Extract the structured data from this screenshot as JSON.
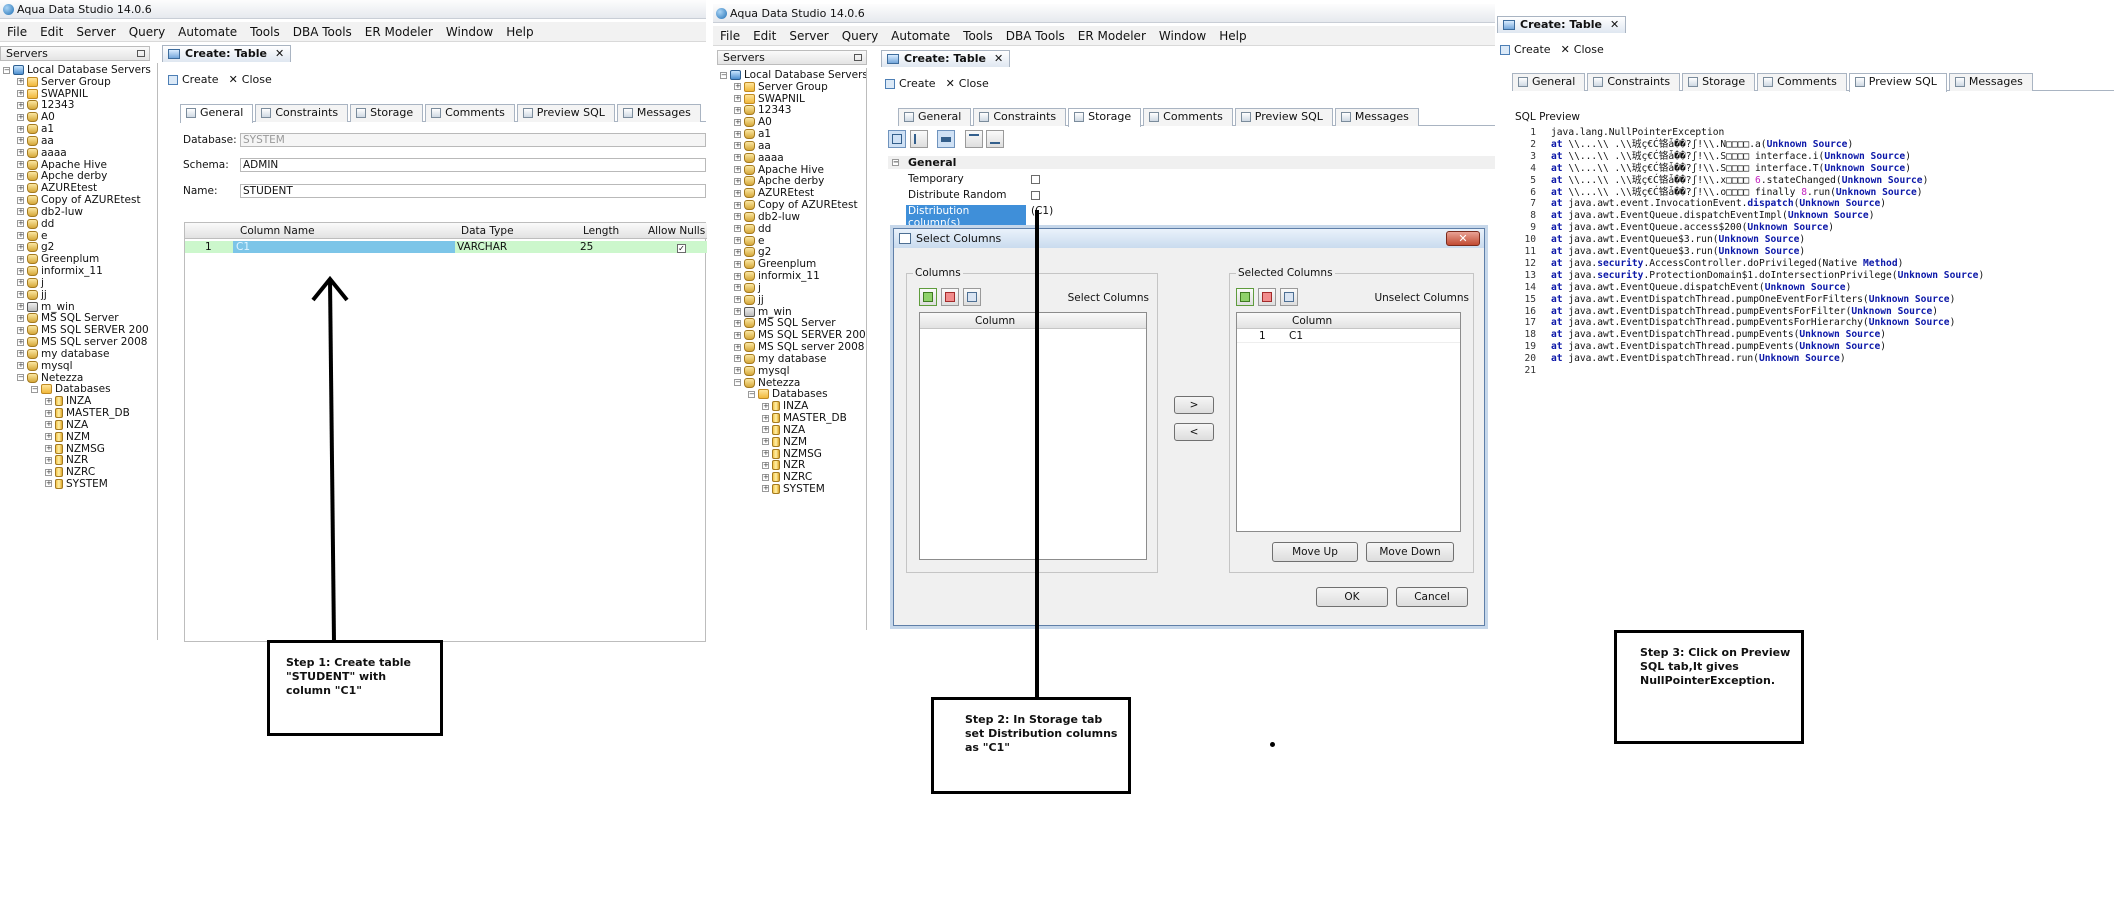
{
  "app_title": "Aqua Data Studio 14.0.6",
  "menu": [
    "File",
    "Edit",
    "Server",
    "Query",
    "Automate",
    "Tools",
    "DBA Tools",
    "ER Modeler",
    "Window",
    "Help"
  ],
  "servers_label": "Servers",
  "tree": {
    "root": "Local Database Servers",
    "items": [
      "Server Group",
      "SWAPNIL",
      "12343",
      "A0",
      "a1",
      "aa",
      "aaaa",
      "Apache Hive",
      "Apche derby",
      "AZUREtest",
      "Copy of AZUREtest",
      "db2-luw",
      "dd",
      "e",
      "g2",
      "Greenplum",
      "informix_11",
      "j",
      "jj",
      "m_win",
      "MS SQL Server",
      "MS SQL SERVER 200",
      "MS SQL server 2008",
      "my database",
      "mysql",
      "Netezza"
    ],
    "databases_label": "Databases",
    "databases": [
      "INZA",
      "MASTER_DB",
      "NZA",
      "NZM",
      "NZMSG",
      "NZR",
      "NZRC",
      "SYSTEM"
    ]
  },
  "doc_tab": "Create: Table",
  "close_tab": "✕",
  "toolbar": {
    "create": "Create",
    "close": "Close",
    "close_glyph": "✕"
  },
  "tabs": [
    "General",
    "Constraints",
    "Storage",
    "Comments",
    "Preview SQL",
    "Messages"
  ],
  "panel1": {
    "database_label": "Database:",
    "database_value": "SYSTEM",
    "schema_label": "Schema:",
    "schema_value": "ADMIN",
    "name_label": "Name:",
    "name_value": "STUDENT",
    "columns_header": [
      "Column Name",
      "Data Type",
      "Length",
      "Allow Nulls"
    ],
    "row": {
      "num": "1",
      "name": "C1",
      "type": "VARCHAR",
      "length": "25",
      "check": "✓"
    }
  },
  "panel2": {
    "section": "General",
    "props": [
      "Temporary",
      "Distribute Random",
      "Distribution column(s)"
    ],
    "distribution_value": "(C1)",
    "dialog": {
      "title": "Select Columns",
      "close_glyph": "✕",
      "columns_legend": "Columns",
      "select_columns": "Select Columns",
      "selected_legend": "Selected Columns",
      "unselect_columns": "Unselect Columns",
      "column_header": "Column",
      "selected_row": {
        "num": "1",
        "name": "C1"
      },
      "add_glyph": ">",
      "remove_glyph": "<",
      "move_up": "Move Up",
      "move_down": "Move Down",
      "ok": "OK",
      "cancel": "Cancel"
    }
  },
  "panel3": {
    "sql_preview_label": "SQL Preview",
    "lines": [
      {
        "n": "1",
        "parts": [
          {
            "t": "java.lang.NullPointerException"
          }
        ]
      },
      {
        "n": "2",
        "parts": [
          {
            "t": "    at ",
            "c": "kw"
          },
          {
            "t": "\\\\...\\\\ .\\\\珬ç€Ć铬ǡ��?ʃǃ\\\\.N□□□□.a("
          },
          {
            "t": "Unknown Source",
            "c": "kw"
          },
          {
            "t": ")"
          }
        ]
      },
      {
        "n": "3",
        "parts": [
          {
            "t": "    at ",
            "c": "kw"
          },
          {
            "t": "\\\\...\\\\ .\\\\珬ç€Ć铬ǡ��?ʃǃ\\\\.S□□□□ interface.i("
          },
          {
            "t": "Unknown Source",
            "c": "kw"
          },
          {
            "t": ")"
          }
        ]
      },
      {
        "n": "4",
        "parts": [
          {
            "t": "    at ",
            "c": "kw"
          },
          {
            "t": "\\\\...\\\\ .\\\\珬ç€Ć铬ǡ��?ʃǃ\\\\.S□□□□ interface.T("
          },
          {
            "t": "Unknown Source",
            "c": "kw"
          },
          {
            "t": ")"
          }
        ]
      },
      {
        "n": "5",
        "parts": [
          {
            "t": "    at ",
            "c": "kw"
          },
          {
            "t": "\\\\...\\\\ .\\\\珬ç€Ć铬ǡ��?ʃǃ\\\\.x□□□□ "
          },
          {
            "t": "6",
            "c": "num"
          },
          {
            "t": ".stateChanged("
          },
          {
            "t": "Unknown Source",
            "c": "kw"
          },
          {
            "t": ")"
          }
        ]
      },
      {
        "n": "6",
        "parts": [
          {
            "t": "    at ",
            "c": "kw"
          },
          {
            "t": "\\\\...\\\\ .\\\\珬ç€Ć铬ǡ��?ʃǃ\\\\.o□□□□ finally "
          },
          {
            "t": "8",
            "c": "num"
          },
          {
            "t": ".run("
          },
          {
            "t": "Unknown Source",
            "c": "kw"
          },
          {
            "t": ")"
          }
        ]
      },
      {
        "n": "7",
        "parts": [
          {
            "t": "    at ",
            "c": "kw"
          },
          {
            "t": "java.awt.event.InvocationEvent."
          },
          {
            "t": "dispatch",
            "c": "kw"
          },
          {
            "t": "("
          },
          {
            "t": "Unknown Source",
            "c": "kw"
          },
          {
            "t": ")"
          }
        ]
      },
      {
        "n": "8",
        "parts": [
          {
            "t": "    at ",
            "c": "kw"
          },
          {
            "t": "java.awt.EventQueue.dispatchEventImpl("
          },
          {
            "t": "Unknown Source",
            "c": "kw"
          },
          {
            "t": ")"
          }
        ]
      },
      {
        "n": "9",
        "parts": [
          {
            "t": "    at ",
            "c": "kw"
          },
          {
            "t": "java.awt.EventQueue.access$200("
          },
          {
            "t": "Unknown Source",
            "c": "kw"
          },
          {
            "t": ")"
          }
        ]
      },
      {
        "n": "10",
        "parts": [
          {
            "t": "    at ",
            "c": "kw"
          },
          {
            "t": "java.awt.EventQueue$3.run("
          },
          {
            "t": "Unknown Source",
            "c": "kw"
          },
          {
            "t": ")"
          }
        ]
      },
      {
        "n": "11",
        "parts": [
          {
            "t": "    at ",
            "c": "kw"
          },
          {
            "t": "java.awt.EventQueue$3.run("
          },
          {
            "t": "Unknown Source",
            "c": "kw"
          },
          {
            "t": ")"
          }
        ]
      },
      {
        "n": "12",
        "parts": [
          {
            "t": "    at ",
            "c": "kw"
          },
          {
            "t": "java."
          },
          {
            "t": "security",
            "c": "kw"
          },
          {
            "t": ".AccessController.doPrivileged(Native "
          },
          {
            "t": "Method",
            "c": "kw"
          },
          {
            "t": ")"
          }
        ]
      },
      {
        "n": "13",
        "parts": [
          {
            "t": "    at ",
            "c": "kw"
          },
          {
            "t": "java."
          },
          {
            "t": "security",
            "c": "kw"
          },
          {
            "t": ".ProtectionDomain$1.doIntersectionPrivilege("
          },
          {
            "t": "Unknown Source",
            "c": "kw"
          },
          {
            "t": ")"
          }
        ]
      },
      {
        "n": "14",
        "parts": [
          {
            "t": "    at ",
            "c": "kw"
          },
          {
            "t": "java.awt.EventQueue.dispatchEvent("
          },
          {
            "t": "Unknown Source",
            "c": "kw"
          },
          {
            "t": ")"
          }
        ]
      },
      {
        "n": "15",
        "parts": [
          {
            "t": "    at ",
            "c": "kw"
          },
          {
            "t": "java.awt.EventDispatchThread.pumpOneEventForFilters("
          },
          {
            "t": "Unknown Source",
            "c": "kw"
          },
          {
            "t": ")"
          }
        ]
      },
      {
        "n": "16",
        "parts": [
          {
            "t": "    at ",
            "c": "kw"
          },
          {
            "t": "java.awt.EventDispatchThread.pumpEventsForFilter("
          },
          {
            "t": "Unknown Source",
            "c": "kw"
          },
          {
            "t": ")"
          }
        ]
      },
      {
        "n": "17",
        "parts": [
          {
            "t": "    at ",
            "c": "kw"
          },
          {
            "t": "java.awt.EventDispatchThread.pumpEventsForHierarchy("
          },
          {
            "t": "Unknown Source",
            "c": "kw"
          },
          {
            "t": ")"
          }
        ]
      },
      {
        "n": "18",
        "parts": [
          {
            "t": "    at ",
            "c": "kw"
          },
          {
            "t": "java.awt.EventDispatchThread.pumpEvents("
          },
          {
            "t": "Unknown Source",
            "c": "kw"
          },
          {
            "t": ")"
          }
        ]
      },
      {
        "n": "19",
        "parts": [
          {
            "t": "    at ",
            "c": "kw"
          },
          {
            "t": "java.awt.EventDispatchThread.pumpEvents("
          },
          {
            "t": "Unknown Source",
            "c": "kw"
          },
          {
            "t": ")"
          }
        ]
      },
      {
        "n": "20",
        "parts": [
          {
            "t": "    at ",
            "c": "kw"
          },
          {
            "t": "java.awt.EventDispatchThread.run("
          },
          {
            "t": "Unknown Source",
            "c": "kw"
          },
          {
            "t": ")"
          }
        ]
      },
      {
        "n": "21",
        "parts": []
      }
    ]
  },
  "steps": {
    "step1": "Step 1: Create table \"STUDENT\" with column \"C1\"",
    "step2": "Step 2: In Storage tab set Distribution columns as \"C1\"",
    "step3": "Step 3: Click on Preview SQL tab,It gives NullPointerException."
  },
  "colors": {
    "selection": "#7cc5e8",
    "row_highlight": "#ccf7cc",
    "keyword": "#0b17a8",
    "number": "#c21fbf"
  }
}
